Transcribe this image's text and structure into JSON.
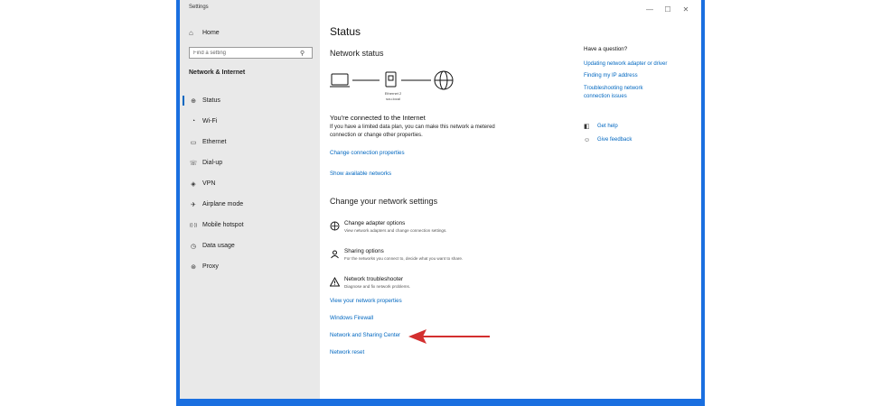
{
  "window": {
    "title": "Settings",
    "controls": {
      "minimize": "—",
      "maximize": "☐",
      "close": "✕"
    }
  },
  "sidebar": {
    "home_label": "Home",
    "search_placeholder": "Find a setting",
    "section_title": "Network & Internet",
    "items": [
      {
        "label": "Status",
        "icon": "status-icon",
        "glyph": "⊕",
        "active": true
      },
      {
        "label": "Wi-Fi",
        "icon": "wifi-icon",
        "glyph": "◔"
      },
      {
        "label": "Ethernet",
        "icon": "ethernet-icon",
        "glyph": "▭"
      },
      {
        "label": "Dial-up",
        "icon": "dialup-icon",
        "glyph": "☏"
      },
      {
        "label": "VPN",
        "icon": "vpn-icon",
        "glyph": "◈"
      },
      {
        "label": "Airplane mode",
        "icon": "airplane-icon",
        "glyph": "✈"
      },
      {
        "label": "Mobile hotspot",
        "icon": "hotspot-icon",
        "glyph": "((·))"
      },
      {
        "label": "Data usage",
        "icon": "data-usage-icon",
        "glyph": "◷"
      },
      {
        "label": "Proxy",
        "icon": "proxy-icon",
        "glyph": "⊛"
      }
    ]
  },
  "main": {
    "title": "Status",
    "network_status_heading": "Network status",
    "diagram_label_line1": "Ethernet 2",
    "diagram_label_line2": "sou.local",
    "connected_title": "You're connected to the Internet",
    "connected_desc": "If you have a limited data plan, you can make this network a metered connection or change other properties.",
    "change_connection_link": "Change connection properties",
    "show_networks_link": "Show available networks",
    "change_settings_heading": "Change your network settings",
    "options": [
      {
        "title": "Change adapter options",
        "desc": "View network adapters and change connection settings.",
        "icon": "adapter-icon"
      },
      {
        "title": "Sharing options",
        "desc": "For the networks you connect to, decide what you want to share.",
        "icon": "sharing-icon"
      },
      {
        "title": "Network troubleshooter",
        "desc": "Diagnose and fix network problems.",
        "icon": "warning-icon"
      }
    ],
    "links": {
      "view_properties": "View your network properties",
      "firewall": "Windows Firewall",
      "sharing_center": "Network and Sharing Center",
      "reset": "Network reset"
    }
  },
  "aside": {
    "question": "Have a question?",
    "links": [
      "Updating network adapter or driver",
      "Finding my IP address",
      "Troubleshooting network connection issues"
    ],
    "get_help": "Get help",
    "give_feedback": "Give feedback"
  },
  "colors": {
    "accent": "#0067c0",
    "sidebar_bg": "#e9e9e9",
    "frame_blue": "#1a6fe0",
    "arrow_red": "#d32f2f"
  }
}
